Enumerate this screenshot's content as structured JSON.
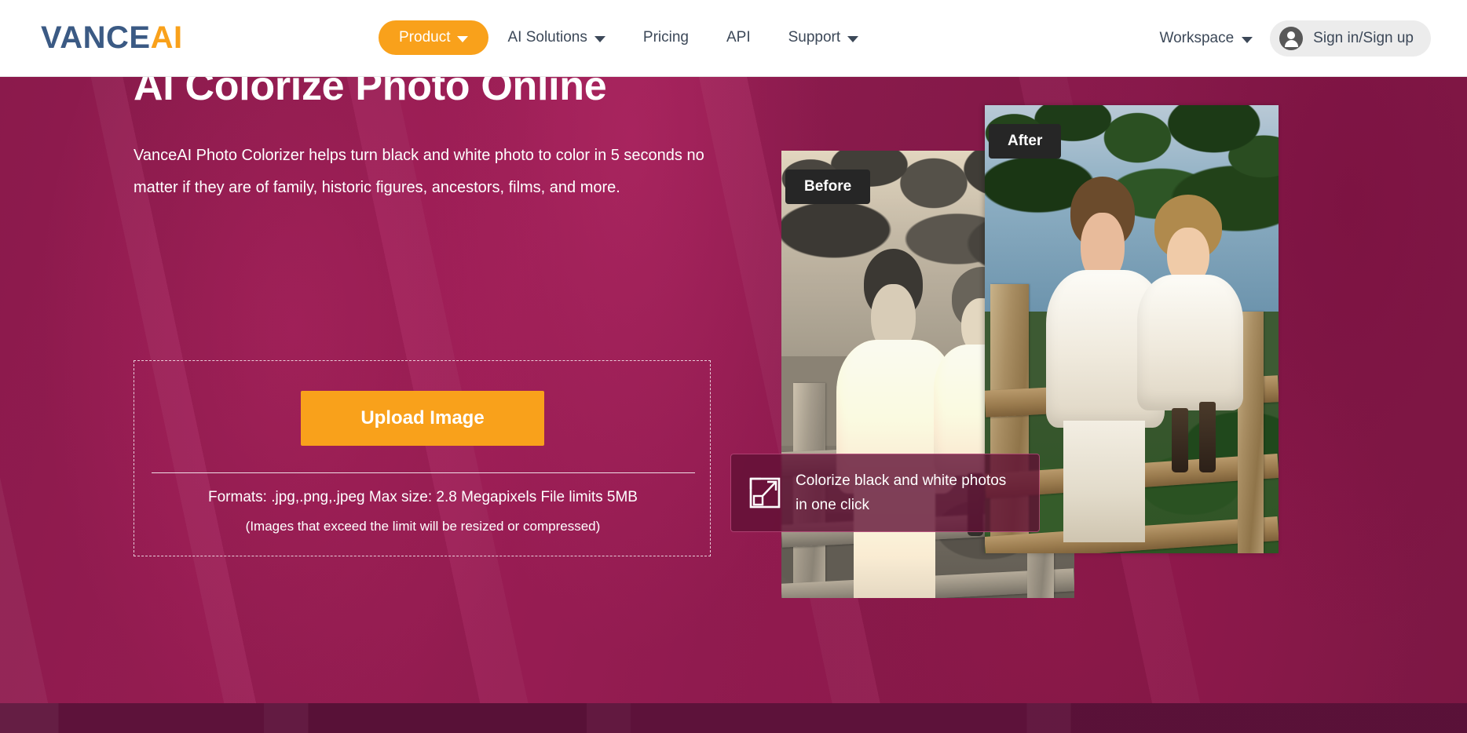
{
  "header": {
    "logo": {
      "part1": "VANCE",
      "part2": "AI"
    },
    "nav": [
      {
        "label": "Product",
        "has_caret": true,
        "active": true
      },
      {
        "label": "AI Solutions",
        "has_caret": true,
        "active": false
      },
      {
        "label": "Pricing",
        "has_caret": false,
        "active": false
      },
      {
        "label": "API",
        "has_caret": false,
        "active": false
      },
      {
        "label": "Support",
        "has_caret": true,
        "active": false
      }
    ],
    "workspace_label": "Workspace",
    "signin_label": "Sign in/Sign up",
    "accent_color": "#f9a11b",
    "nav_text_color": "#3c4858"
  },
  "hero": {
    "title": "AI Colorize Photo Online",
    "description": "VanceAI Photo Colorizer helps turn black and white photo to color in 5 seconds no matter if they are of family, historic figures, ancestors, films, and more.",
    "background_color": "#8e1b4e",
    "band_color": "#5d123a"
  },
  "upload": {
    "button_label": "Upload Image",
    "formats_line": "Formats: .jpg,.png,.jpeg Max size: 2.8 Megapixels File limits 5MB",
    "note_line": "(Images that exceed the limit will be resized or compressed)",
    "button_color": "#f9a11b"
  },
  "comparison": {
    "before_label": "Before",
    "after_label": "After",
    "label_bg": "#262626"
  },
  "callout": {
    "text": "Colorize black and white photos in one click",
    "icon": "expand-arrow-icon",
    "border_color": "#ff78b4"
  }
}
